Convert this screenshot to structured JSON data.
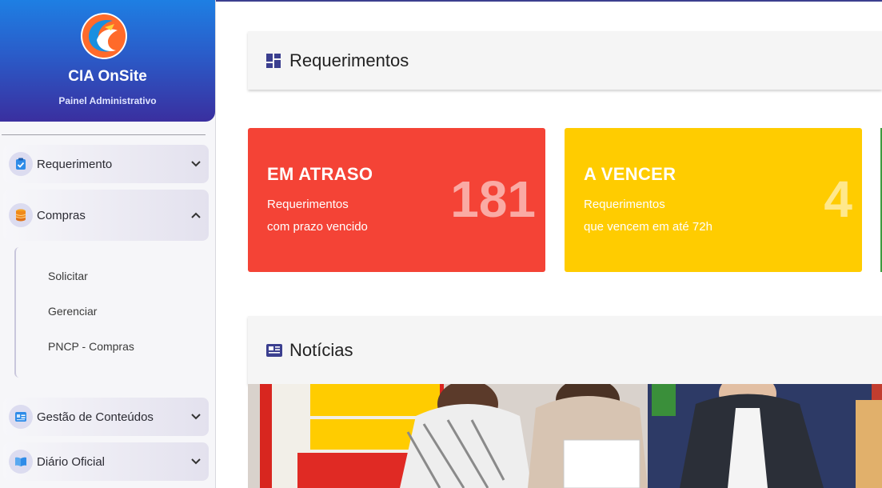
{
  "brand": {
    "title": "CIA OnSite",
    "subtitle": "Painel Administrativo"
  },
  "sidebar": {
    "items": [
      {
        "label": "Requerimento",
        "icon": "clipboard-check-icon",
        "expanded": false
      },
      {
        "label": "Compras",
        "icon": "database-icon",
        "expanded": true
      },
      {
        "label": "Gestão de Conteúdos",
        "icon": "id-card-icon",
        "expanded": false
      },
      {
        "label": "Diário Oficial",
        "icon": "open-book-icon",
        "expanded": false
      }
    ],
    "compras_submenu": [
      "Solicitar",
      "Gerenciar",
      "PNCP - Compras"
    ]
  },
  "requerimentos": {
    "title": "Requerimentos",
    "cards": [
      {
        "label": "EM ATRASO",
        "desc_line1": "Requerimentos",
        "desc_line2": "com prazo vencido",
        "value": "181",
        "color": "#f44336"
      },
      {
        "label": "A VENCER",
        "desc_line1": "Requerimentos",
        "desc_line2": "que vencem em até 72h",
        "value": "4",
        "color": "#ffcc00"
      }
    ]
  },
  "noticias": {
    "title": "Notícias"
  },
  "colors": {
    "brand_gradient_top": "#1e7fe3",
    "brand_gradient_bottom": "#3a2f9f",
    "accent": "#3b3f8f"
  }
}
